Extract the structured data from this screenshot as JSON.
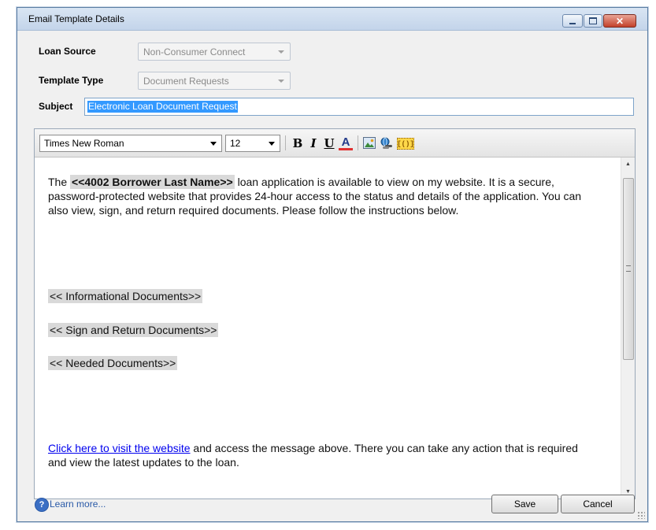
{
  "window": {
    "title": "Email Template Details"
  },
  "form": {
    "loan_source_label": "Loan Source",
    "loan_source_value": "Non-Consumer Connect",
    "template_type_label": "Template Type",
    "template_type_value": "Document Requests",
    "subject_label": "Subject",
    "subject_value": "Electronic Loan Document Request"
  },
  "toolbar": {
    "font_value": "Times New Roman",
    "size_value": "12",
    "bold": "B",
    "italic": "I",
    "underline": "U",
    "font_color": "A",
    "field_insert": "[()]"
  },
  "body": {
    "intro_before": "The ",
    "borrower_field": "<<4002 Borrower Last Name>>",
    "intro_after": " loan application is available to view on my website. It is a secure, password-protected website that provides 24-hour access to the status and details of the application. You can also view, sign, and return required documents. Please follow the instructions below.",
    "informational_docs": "<< Informational Documents>>",
    "sign_return_docs": "<< Sign and Return Documents>>",
    "needed_docs": "<< Needed Documents>>",
    "link_text": "Click here to visit the website",
    "closing_after": " and access the message above. There you can take any action that is required and view the latest updates to the loan."
  },
  "footer": {
    "learn_more": "Learn more...",
    "save_label": "Save",
    "cancel_label": "Cancel"
  },
  "colors": {
    "selection": "#3399ff",
    "link": "#0000ee",
    "close_button": "#c3412a"
  }
}
